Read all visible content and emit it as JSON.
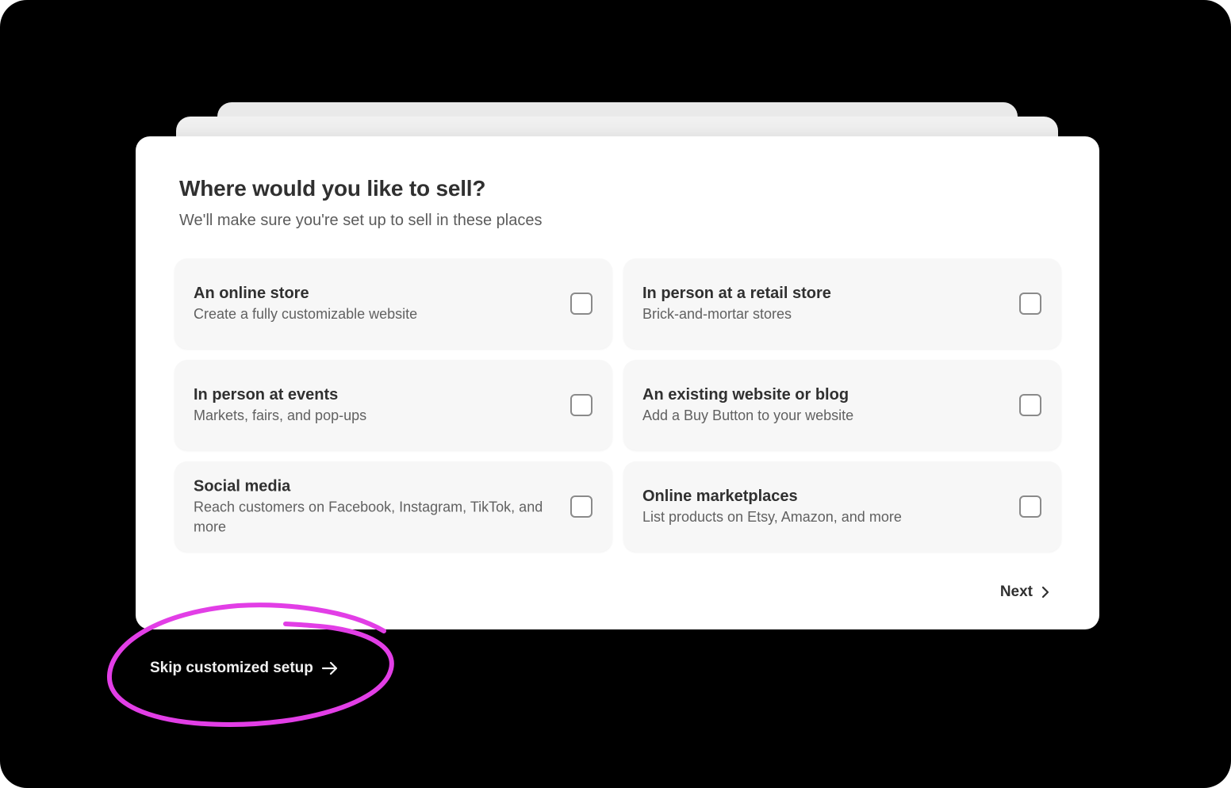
{
  "page": {
    "title": "Where would you like to sell?",
    "subtitle": "We'll make sure you're set up to sell in these places"
  },
  "options": [
    {
      "title": "An online store",
      "description": "Create a fully customizable website",
      "checked": false
    },
    {
      "title": "In person at a retail store",
      "description": "Brick-and-mortar stores",
      "checked": false
    },
    {
      "title": "In person at events",
      "description": "Markets, fairs, and pop-ups",
      "checked": false
    },
    {
      "title": "An existing website or blog",
      "description": "Add a Buy Button to your website",
      "checked": false
    },
    {
      "title": "Social media",
      "description": "Reach customers on Facebook, Instagram, TikTok, and more",
      "checked": false
    },
    {
      "title": "Online marketplaces",
      "description": "List products on Etsy, Amazon, and more",
      "checked": false
    }
  ],
  "footer": {
    "next_label": "Next",
    "skip_label": "Skip customized setup"
  },
  "icons": {
    "next": "chevron-right-icon",
    "skip": "arrow-right-icon"
  },
  "colors": {
    "background": "#000000",
    "card": "#ffffff",
    "option_bg": "#f7f7f7",
    "text_primary": "#303030",
    "text_secondary": "#616161",
    "annotation": "#e23ee6"
  }
}
